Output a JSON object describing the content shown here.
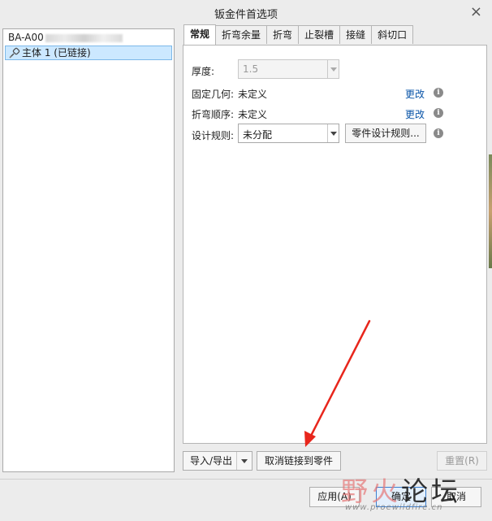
{
  "window": {
    "title": "钣金件首选项",
    "close_glyph": "×"
  },
  "tree": {
    "root_label": "BA-A00",
    "item_label": "主体 1 (已链接)",
    "item_icon": "link-icon"
  },
  "tabs": [
    {
      "label": "常规",
      "active": true
    },
    {
      "label": "折弯余量"
    },
    {
      "label": "折弯"
    },
    {
      "label": "止裂槽"
    },
    {
      "label": "接缝"
    },
    {
      "label": "斜切口"
    }
  ],
  "general": {
    "thickness_label": "厚度:",
    "thickness_value": "1.5",
    "fixed_geom_label": "固定几何:",
    "fixed_geom_value": "未定义",
    "fixed_geom_link": "更改",
    "bend_order_label": "折弯顺序:",
    "bend_order_value": "未定义",
    "bend_order_link": "更改",
    "design_rules_label": "设计规则:",
    "design_rules_value": "未分配",
    "part_design_rules_button": "零件设计规则...",
    "info_glyph": "i"
  },
  "bottom": {
    "import_export": "导入/导出",
    "unlink": "取消链接到零件",
    "reset": "重置(R)"
  },
  "footer": {
    "apply": "应用(A)",
    "ok": "确定",
    "cancel": "取消"
  },
  "watermark": {
    "part1": "野火",
    "part2": "论坛",
    "url": "www.proewildfire.cn"
  },
  "colors": {
    "accent": "#0a55a8",
    "selection": "#cce8ff",
    "annotation_arrow": "#e8261c"
  }
}
